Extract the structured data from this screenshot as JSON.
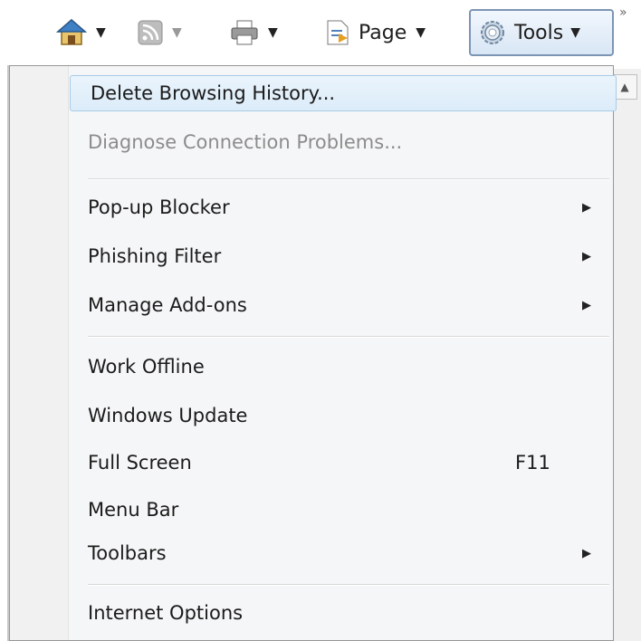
{
  "toolbar": {
    "page_label": "Page",
    "tools_label": "Tools",
    "overflow_glyph": "»"
  },
  "menu": {
    "items": [
      {
        "label": "Delete Browsing History...",
        "shortcut": "",
        "submenu": false,
        "state": "highlighted"
      },
      {
        "label": "Diagnose Connection Problems...",
        "shortcut": "",
        "submenu": false,
        "state": "disabled"
      },
      {
        "label": "Pop-up Blocker",
        "shortcut": "",
        "submenu": true,
        "state": "normal"
      },
      {
        "label": "Phishing Filter",
        "shortcut": "",
        "submenu": true,
        "state": "normal"
      },
      {
        "label": "Manage Add-ons",
        "shortcut": "",
        "submenu": true,
        "state": "normal"
      },
      {
        "label": "Work Offline",
        "shortcut": "",
        "submenu": false,
        "state": "normal"
      },
      {
        "label": "Windows Update",
        "shortcut": "",
        "submenu": false,
        "state": "normal"
      },
      {
        "label": "Full Screen",
        "shortcut": "F11",
        "submenu": false,
        "state": "normal"
      },
      {
        "label": "Menu Bar",
        "shortcut": "",
        "submenu": false,
        "state": "normal"
      },
      {
        "label": "Toolbars",
        "shortcut": "",
        "submenu": true,
        "state": "normal"
      },
      {
        "label": "Internet Options",
        "shortcut": "",
        "submenu": false,
        "state": "normal"
      }
    ]
  },
  "icons": {
    "home": "home-icon",
    "feed": "rss-feed-icon",
    "print": "printer-icon",
    "page": "page-icon",
    "tools": "gear-icon"
  },
  "colors": {
    "highlight_fill": "#dcecf9",
    "highlight_border": "#a8cbe8",
    "disabled_text": "#8c8c8c",
    "tools_border": "#7d95b5"
  }
}
